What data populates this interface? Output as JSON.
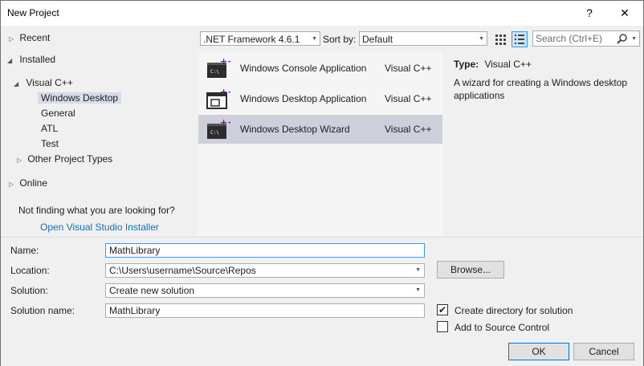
{
  "window": {
    "title": "New Project",
    "help_label": "?",
    "close_label": "✕"
  },
  "tree": {
    "recent": "Recent",
    "installed": "Installed",
    "visual_cpp": "Visual C++",
    "windows_desktop": "Windows Desktop",
    "general": "General",
    "atl": "ATL",
    "test": "Test",
    "other_project_types": "Other Project Types",
    "online": "Online",
    "not_finding": "Not finding what you are looking for?",
    "open_installer": "Open Visual Studio Installer"
  },
  "toolbar": {
    "framework": ".NET Framework 4.6.1",
    "sort_by_label": "Sort by:",
    "sort_value": "Default",
    "search_placeholder": "Search (Ctrl+E)"
  },
  "templates": [
    {
      "name": "Windows Console Application",
      "language": "Visual C++"
    },
    {
      "name": "Windows Desktop Application",
      "language": "Visual C++"
    },
    {
      "name": "Windows Desktop Wizard",
      "language": "Visual C++"
    }
  ],
  "details": {
    "type_label": "Type:",
    "type_value": "Visual C++",
    "description": "A wizard for creating a Windows desktop applications"
  },
  "form": {
    "name_label": "Name:",
    "name_value": "MathLibrary",
    "location_label": "Location:",
    "location_value": "C:\\Users\\username\\Source\\Repos",
    "solution_label": "Solution:",
    "solution_value": "Create new solution",
    "solution_name_label": "Solution name:",
    "solution_name_value": "MathLibrary",
    "browse_label": "Browse...",
    "create_dir_label": "Create directory for solution",
    "create_dir_checked": true,
    "source_control_label": "Add to Source Control",
    "source_control_checked": false,
    "ok_label": "OK",
    "cancel_label": "Cancel"
  },
  "colors": {
    "accent": "#0078d7",
    "link": "#0e70c0",
    "selected": "#cdd0db",
    "cpp_badge": "#68217a"
  }
}
